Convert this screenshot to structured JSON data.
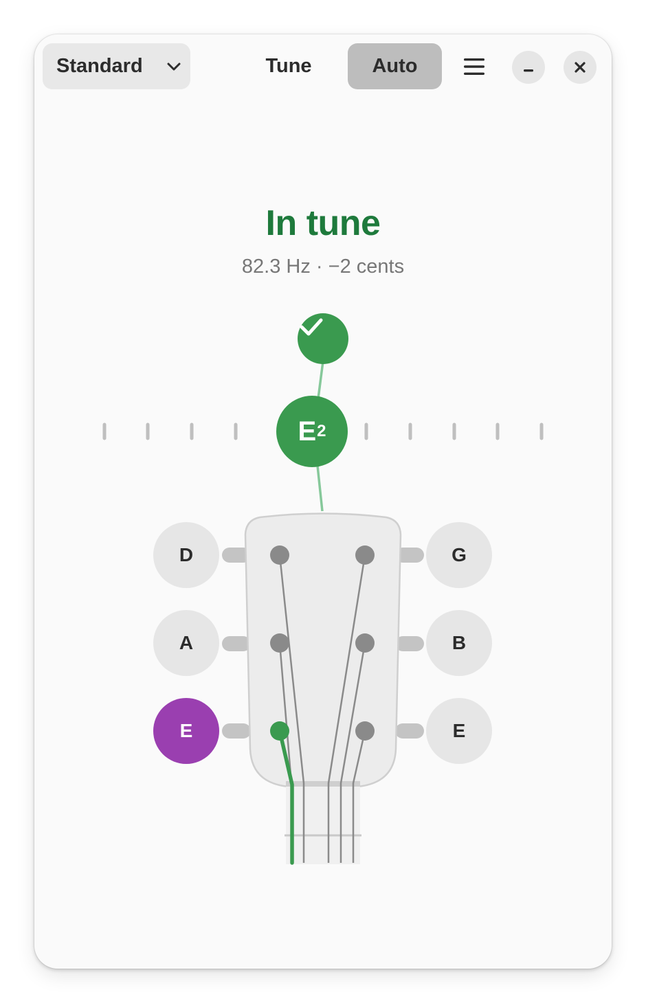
{
  "header": {
    "preset_label": "Standard",
    "mode_tune_label": "Tune",
    "mode_auto_label": "Auto",
    "active_mode": "Auto"
  },
  "status": {
    "title": "In tune",
    "readout": "82.3 Hz · −2 cents",
    "note": "E",
    "octave": "2"
  },
  "strings": {
    "left": [
      {
        "note": "D",
        "active": false
      },
      {
        "note": "A",
        "active": false
      },
      {
        "note": "E",
        "active": true
      }
    ],
    "right": [
      {
        "note": "G",
        "active": false
      },
      {
        "note": "B",
        "active": false
      },
      {
        "note": "E",
        "active": false
      }
    ]
  },
  "icons": {
    "preset_dropdown": "chevron-down-icon",
    "menu": "hamburger-menu-icon",
    "minimize": "minimize-icon",
    "close": "close-icon",
    "status": "checkmark-icon"
  },
  "colors": {
    "in_tune": "#1e7a3c",
    "meter_green": "#3a9a4f",
    "active_string": "#9a3fb0",
    "button_bg": "#e6e6e6",
    "active_mode_bg": "#bdbdbd"
  }
}
